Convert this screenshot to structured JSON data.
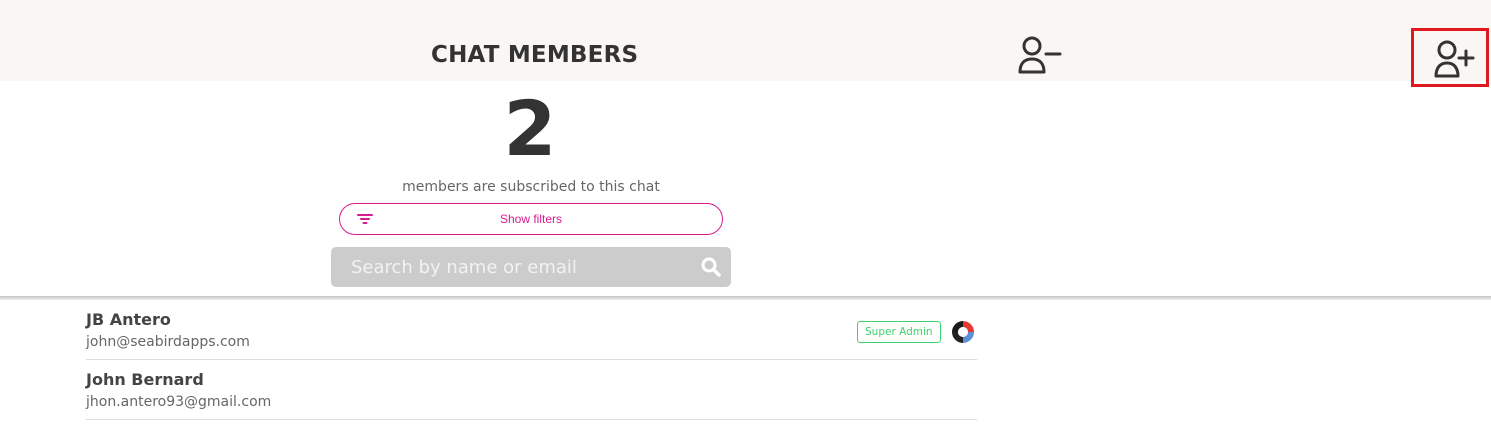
{
  "header": {
    "title": "CHAT MEMBERS"
  },
  "summary": {
    "count": "2",
    "subtitle": "members are subscribed to this chat"
  },
  "filters": {
    "label": "Show filters"
  },
  "search": {
    "placeholder": "Search by name or email"
  },
  "members": [
    {
      "name": "JB Antero",
      "email": "john@seabirdapps.com",
      "role": "Super Admin"
    },
    {
      "name": "John Bernard",
      "email": "jhon.antero93@gmail.com"
    }
  ],
  "icons": {
    "remove_member": "remove-member-icon",
    "add_member": "add-member-icon",
    "filter": "filter-icon",
    "search": "search-icon",
    "avatar": "avatar-icon"
  },
  "colors": {
    "header_bg": "#faf6f3",
    "accent_pink": "#d81b8c",
    "badge_green": "#3fd16b",
    "highlight_red": "#e0191d",
    "search_bg": "#cccccc"
  }
}
